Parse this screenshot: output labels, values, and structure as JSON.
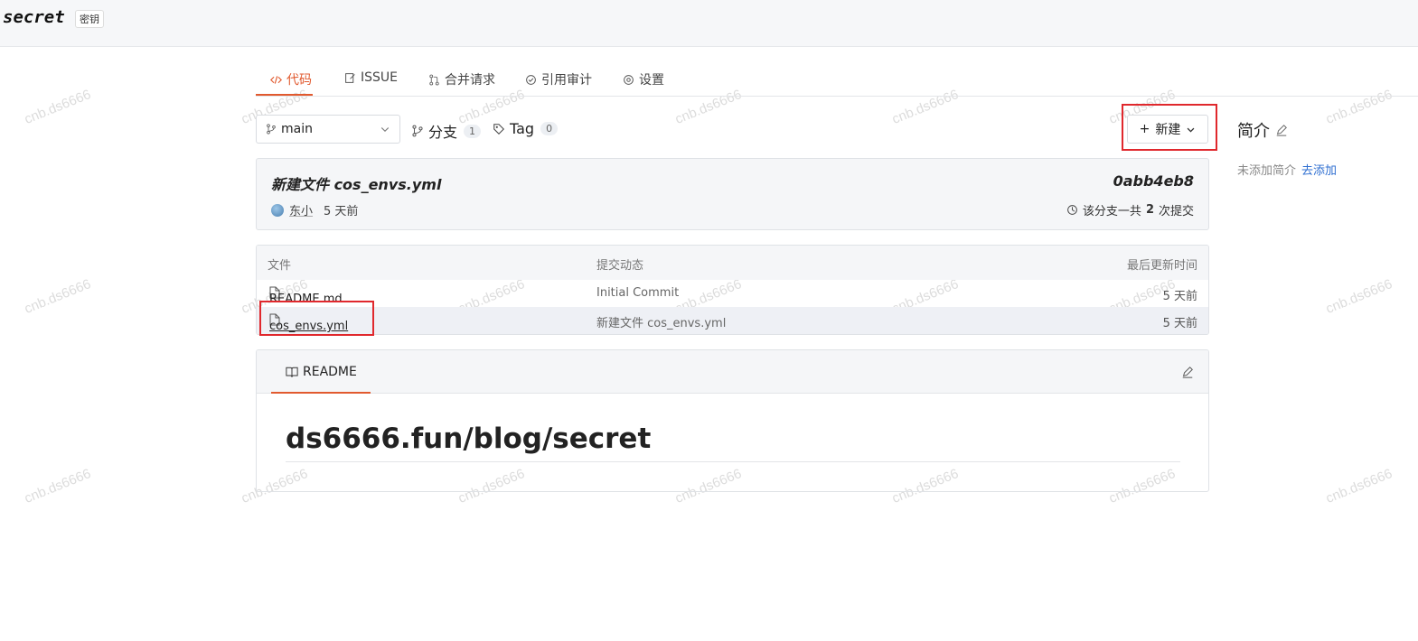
{
  "repo": {
    "name": "secret",
    "tag": "密钥"
  },
  "watermark": "cnb.ds6666",
  "tabs": [
    {
      "label": "代码",
      "icon": "code-icon",
      "active": true
    },
    {
      "label": "ISSUE",
      "icon": "issue-icon",
      "active": false
    },
    {
      "label": "合并请求",
      "icon": "pull-request-icon",
      "active": false
    },
    {
      "label": "引用审计",
      "icon": "audit-icon",
      "active": false
    },
    {
      "label": "设置",
      "icon": "gear-icon",
      "active": false
    }
  ],
  "toolbar": {
    "branch": "main",
    "branches_label": "分支",
    "branches_count": "1",
    "tags_label": "Tag",
    "tags_count": "0",
    "new_label": "新建"
  },
  "sidebar": {
    "title": "简介",
    "desc": "未添加简介",
    "add_link": "去添加"
  },
  "commit": {
    "message": "新建文件 cos_envs.yml",
    "hash": "0abb4eb8",
    "author": "东小",
    "time": "5 天前",
    "count_prefix": "该分支一共",
    "count": "2",
    "count_suffix": "次提交"
  },
  "files": {
    "headers": {
      "file": "文件",
      "commit": "提交动态",
      "updated": "最后更新时间"
    },
    "rows": [
      {
        "name": "README.md",
        "message": "Initial Commit",
        "time": "5 天前"
      },
      {
        "name": "cos_envs.yml",
        "message": "新建文件 cos_envs.yml",
        "time": "5 天前"
      }
    ]
  },
  "readme": {
    "tab": "README",
    "heading": "ds6666.fun/blog/secret"
  },
  "colors": {
    "accent": "#e15a2f",
    "highlight_box": "#e0282d",
    "link": "#2f6fd1"
  }
}
